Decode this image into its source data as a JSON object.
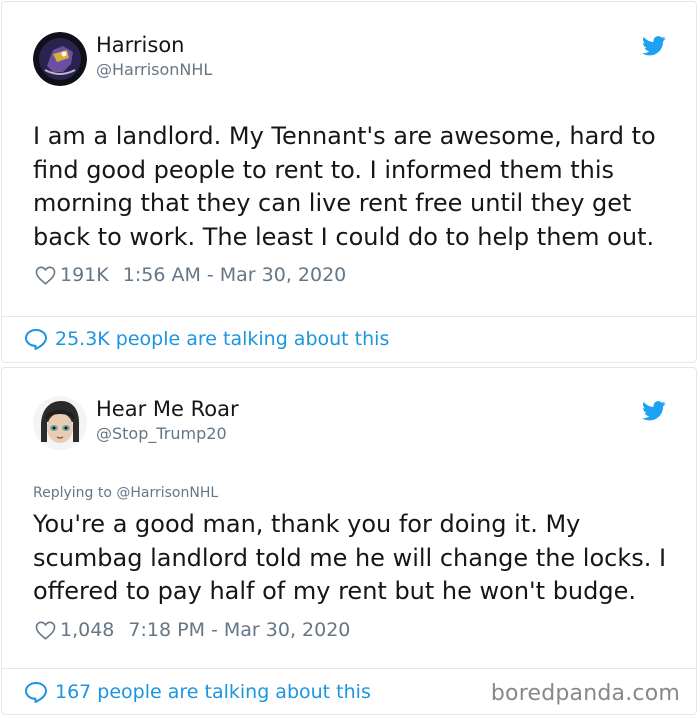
{
  "tweets": [
    {
      "author": {
        "name": "Harrison",
        "handle": "@HarrisonNHL"
      },
      "replying_to": "",
      "text": "I am a landlord. My Tennant's are awesome, hard to find good people to rent to. I informed them this morning that they can live rent free until they get back to work. The least I could do to help them out.",
      "likes": "191K",
      "timestamp": "1:56 AM - Mar 30, 2020",
      "talking": "25.3K people are talking about this"
    },
    {
      "author": {
        "name": "Hear Me Roar",
        "handle": "@Stop_Trump20"
      },
      "replying_to": "Replying to @HarrisonNHL",
      "text": "You're a good man, thank you for doing it. My scumbag landlord told me he will change the locks. I offered to pay half of my rent but he won't budge.",
      "likes": "1,048",
      "timestamp": "7:18 PM - Mar 30, 2020",
      "talking": "167 people are talking about this"
    }
  ],
  "watermark": "boredpanda.com",
  "colors": {
    "twitter_blue": "#1da1f2",
    "link_blue": "#1b95e0",
    "muted": "#657786",
    "border": "#e1e8ed"
  },
  "icons": [
    "twitter-bird-icon",
    "heart-icon",
    "speech-bubble-icon"
  ]
}
